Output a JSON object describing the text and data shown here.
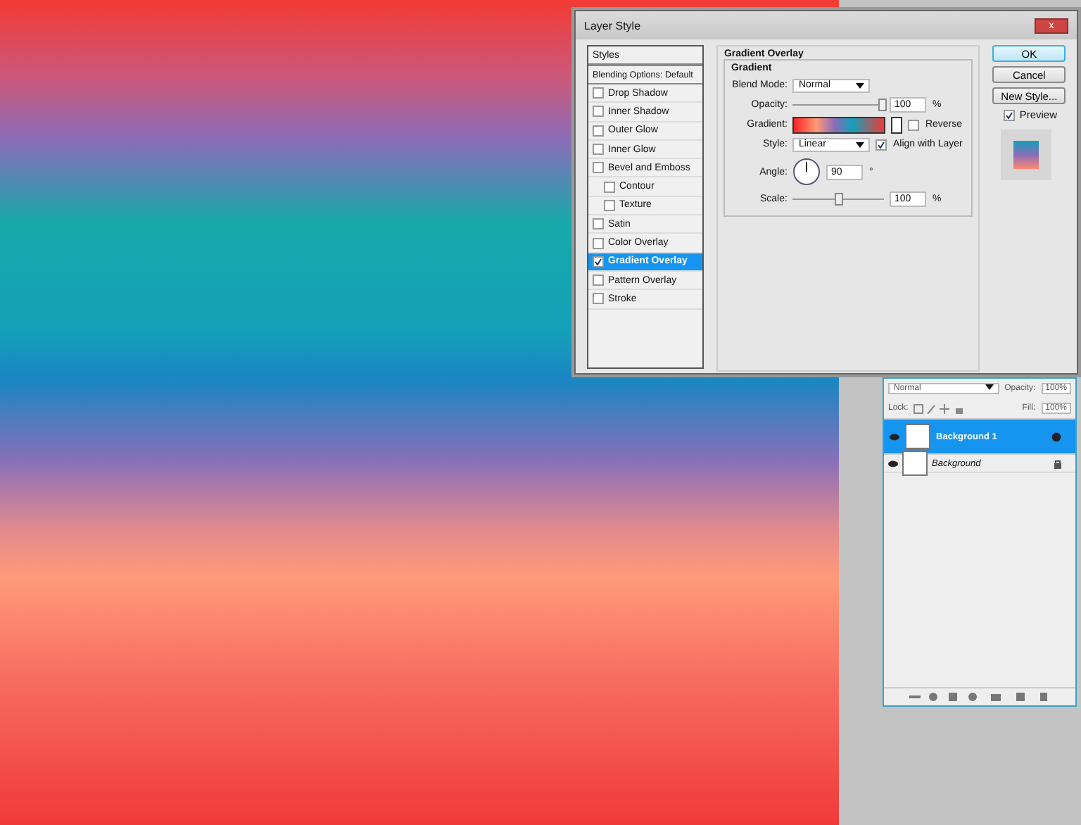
{
  "dialog": {
    "title": "Layer Style",
    "close_label": "x",
    "styles_header": "Styles",
    "blending_options": "Blending Options: Default",
    "styles": [
      {
        "label": "Drop Shadow",
        "checked": false,
        "selected": false
      },
      {
        "label": "Inner Shadow",
        "checked": false,
        "selected": false
      },
      {
        "label": "Outer Glow",
        "checked": false,
        "selected": false
      },
      {
        "label": "Inner Glow",
        "checked": false,
        "selected": false
      },
      {
        "label": "Bevel and Emboss",
        "checked": false,
        "selected": false,
        "children": [
          {
            "label": "Contour",
            "checked": false,
            "selected": false
          },
          {
            "label": "Texture",
            "checked": false,
            "selected": false
          }
        ]
      },
      {
        "label": "Satin",
        "checked": false,
        "selected": false
      },
      {
        "label": "Color Overlay",
        "checked": false,
        "selected": false
      },
      {
        "label": "Gradient Overlay",
        "checked": true,
        "selected": true
      },
      {
        "label": "Pattern Overlay",
        "checked": false,
        "selected": false
      },
      {
        "label": "Stroke",
        "checked": false,
        "selected": false
      }
    ],
    "section_title": "Gradient Overlay",
    "group_title": "Gradient",
    "blend_mode": {
      "label": "Blend Mode:",
      "value": "Normal"
    },
    "opacity": {
      "label": "Opacity:",
      "level": 0.97,
      "value": "100",
      "unit": "%"
    },
    "gradient": {
      "label": "Gradient:",
      "reverse": {
        "label": "Reverse",
        "checked": false
      }
    },
    "style": {
      "label": "Style:",
      "value": "Linear",
      "align": {
        "label": "Align with Layer",
        "checked": true
      }
    },
    "angle": {
      "label": "Angle:",
      "value": "90",
      "unit": "°"
    },
    "scale": {
      "label": "Scale:",
      "level": 0.5,
      "value": "100",
      "unit": "%"
    },
    "buttons": [
      "OK",
      "Cancel",
      "New Style..."
    ],
    "preview": {
      "label": "Preview",
      "checked": true
    }
  },
  "layers_panel": {
    "blend_mode": "Normal",
    "opacity_label": "Opacity:",
    "opacity": "100%",
    "lock_label": "Lock:",
    "fill_label": "Fill:",
    "fill": "100%",
    "layers": [
      {
        "name": "Background 1",
        "selected": true,
        "italic": false
      },
      {
        "name": "Background",
        "selected": false,
        "italic": true
      }
    ]
  }
}
